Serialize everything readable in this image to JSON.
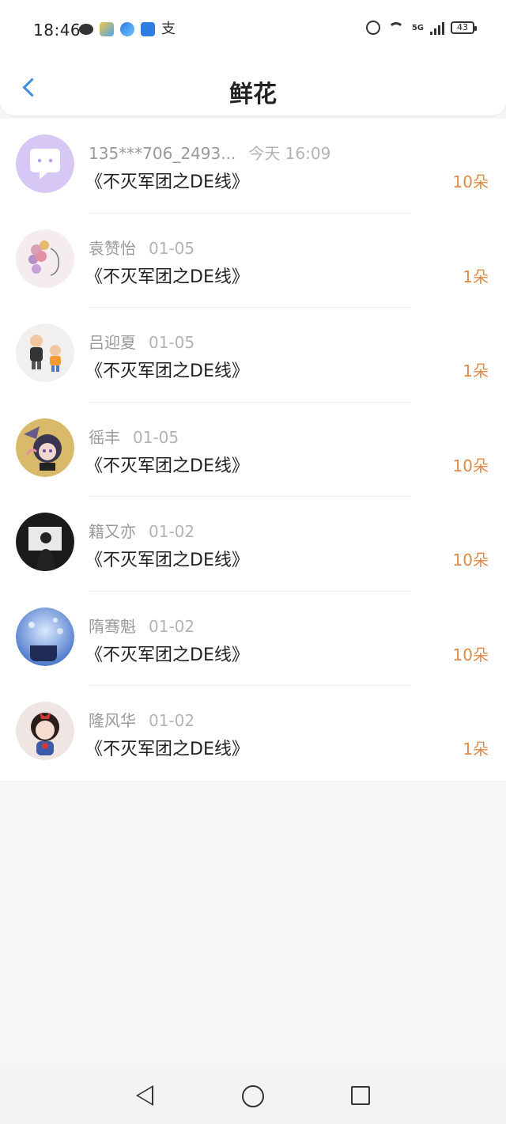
{
  "status_bar": {
    "time": "18:46",
    "battery": "43",
    "network": "5G"
  },
  "header": {
    "title": "鲜花"
  },
  "items": [
    {
      "name": "135***706_2493...",
      "date": "今天 16:09",
      "book": "《不灭军团之DE线》",
      "amount": "10朵",
      "avatar": "chat-bubble-avatar"
    },
    {
      "name": "袁赞怡",
      "date": "01-05",
      "book": "《不灭军团之DE线》",
      "amount": "1朵",
      "avatar": "flower-girl-avatar"
    },
    {
      "name": "吕迎夏",
      "date": "01-05",
      "book": "《不灭军团之DE线》",
      "amount": "1朵",
      "avatar": "cartoon-kids-avatar"
    },
    {
      "name": "徭丰",
      "date": "01-05",
      "book": "《不灭军团之DE线》",
      "amount": "10朵",
      "avatar": "anime-character-avatar"
    },
    {
      "name": "籍又亦",
      "date": "01-02",
      "book": "《不灭军团之DE线》",
      "amount": "10朵",
      "avatar": "silhouette-avatar"
    },
    {
      "name": "隋骞魁",
      "date": "01-02",
      "book": "《不灭军团之DE线》",
      "amount": "10朵",
      "avatar": "cup-bokeh-avatar"
    },
    {
      "name": "隆风华",
      "date": "01-02",
      "book": "《不灭军团之DE线》",
      "amount": "1朵",
      "avatar": "cartoon-girl-avatar"
    }
  ],
  "colors": {
    "accent_blue": "#3c8fe0",
    "amount_orange": "#e08a4a",
    "background": "#f7f5f6"
  }
}
